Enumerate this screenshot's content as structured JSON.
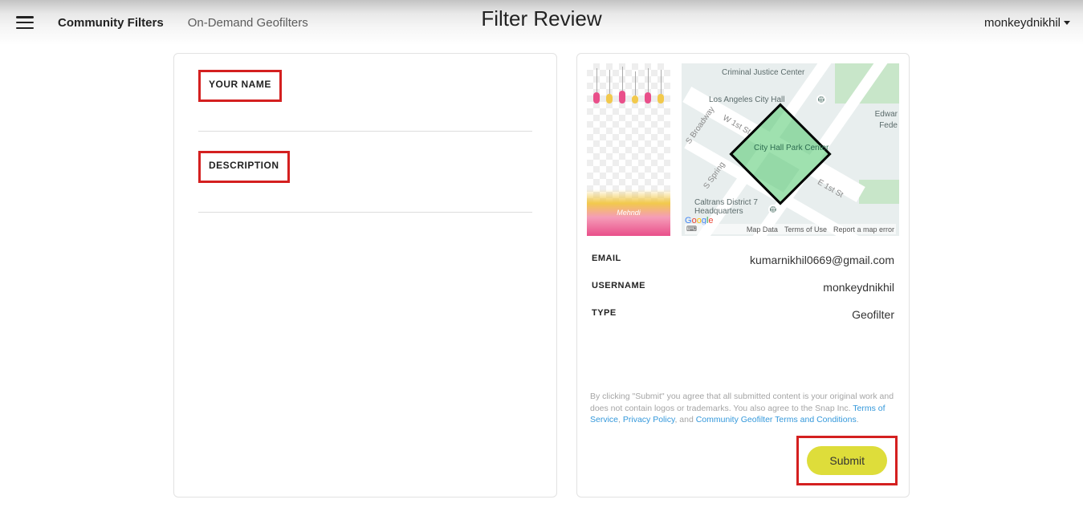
{
  "header": {
    "title": "Filter Review",
    "tabs": [
      {
        "label": "Community Filters",
        "active": true
      },
      {
        "label": "On-Demand Geofilters",
        "active": false
      }
    ],
    "user": "monkeydnikhil"
  },
  "form": {
    "name_label": "YOUR NAME",
    "description_label": "DESCRIPTION"
  },
  "preview": {
    "banner_text": "Mehndi"
  },
  "map": {
    "labels": {
      "criminal_justice": "Criminal Justice Center",
      "city_hall": "Los Angeles City Hall",
      "edward": "Edwar",
      "fede": "Fede",
      "caltrans": "Caltrans District 7 Headquarters",
      "geo_area": "City Hall Park Center"
    },
    "roads": {
      "w1st": "W 1st St",
      "e1st": "E 1st St",
      "broadway": "S Broadway",
      "spring": "S Spring"
    },
    "attrib": {
      "mapdata": "Map Data",
      "tou": "Terms of Use",
      "report": "Report a map error"
    },
    "logo": "Google"
  },
  "info": {
    "email_key": "EMAIL",
    "email_val": "kumarnikhil0669@gmail.com",
    "username_key": "USERNAME",
    "username_val": "monkeydnikhil",
    "type_key": "TYPE",
    "type_val": "Geofilter"
  },
  "legal": {
    "pre": "By clicking \"Submit\" you agree that all submitted content is your original work and does not contain logos or trademarks. You also agree to the Snap Inc. ",
    "tos": "Terms of Service",
    "sep1": ", ",
    "privacy": "Privacy Policy",
    "sep2": ", and ",
    "geo_terms": "Community Geofilter Terms and Conditions",
    "end": "."
  },
  "submit": {
    "label": "Submit"
  }
}
